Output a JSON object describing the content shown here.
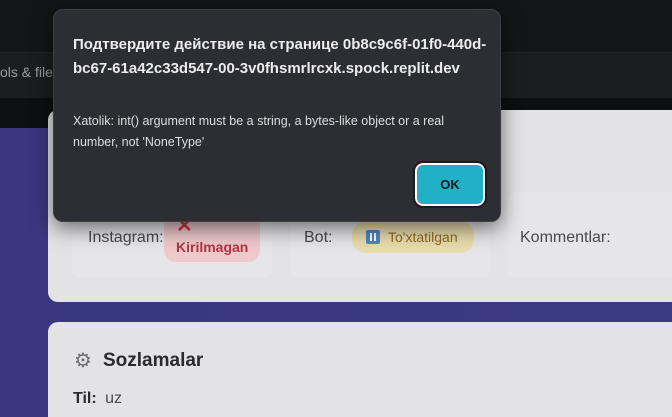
{
  "browser": {
    "tools_tab_label": "ols & files"
  },
  "status": {
    "instagram_label": "Instagram:",
    "instagram_status": "Kirilmagan",
    "instagram_icon": "x-mark-icon",
    "bot_label": "Bot:",
    "bot_status": "To'xtatilgan",
    "bot_icon": "pause-icon",
    "comments_label": "Kommentlar:"
  },
  "settings": {
    "icon": "gear-icon",
    "title": "Sozlamalar",
    "language_key": "Til:",
    "language_value": "uz"
  },
  "dialog": {
    "title": "Подтвердите действие на странице 0b8c9c6f-01f0-440d-bc67-61a42c33d547-00-3v0fhsmrlrcxk.spock.replit.dev",
    "message": "Xatolik: int() argument must be a string, a bytes-like object or a real number, not 'NoneType'",
    "ok_label": "OK"
  },
  "colors": {
    "dialog_bg": "#2d2e33",
    "ok_button": "#22b0c6",
    "page_bg": "#3e3b87",
    "error_badge": "#efc9cc",
    "warn_badge": "#e9dcae"
  }
}
